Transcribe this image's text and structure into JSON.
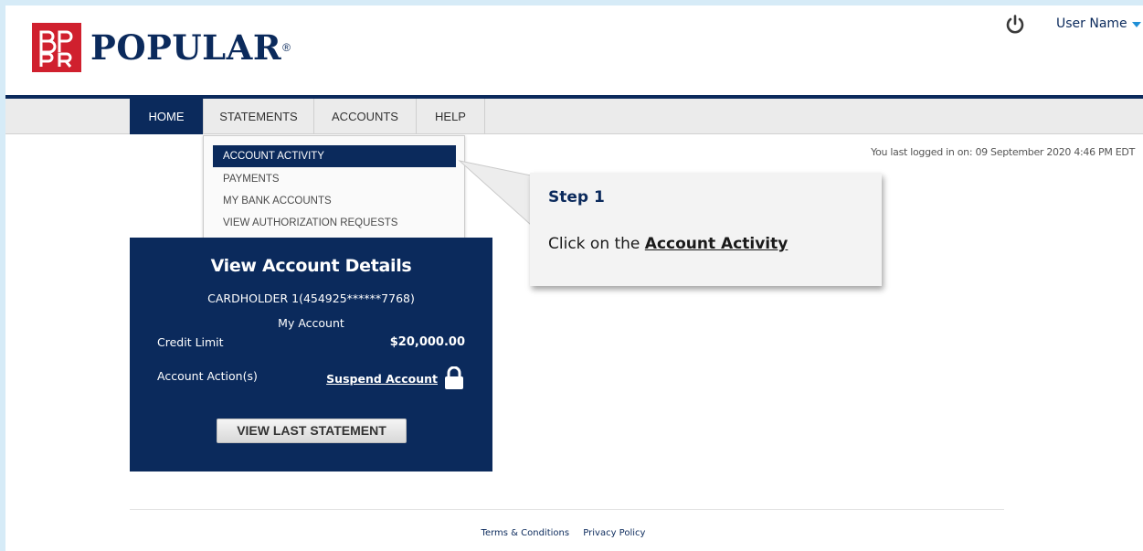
{
  "header": {
    "brand": "POPULAR",
    "brand_mark": "®",
    "user_name": "User Name"
  },
  "nav": {
    "items": [
      {
        "label": "HOME",
        "active": true
      },
      {
        "label": "STATEMENTS",
        "active": false
      },
      {
        "label": "ACCOUNTS",
        "active": false
      },
      {
        "label": "HELP",
        "active": false
      }
    ]
  },
  "dropdown": {
    "items": [
      {
        "label": "ACCOUNT ACTIVITY",
        "selected": true
      },
      {
        "label": "PAYMENTS",
        "selected": false
      },
      {
        "label": "MY BANK ACCOUNTS",
        "selected": false
      },
      {
        "label": "VIEW AUTHORIZATION REQUESTS",
        "selected": false
      }
    ]
  },
  "last_login": "You last logged in on: 09 September 2020 4:46 PM EDT",
  "callout": {
    "title": "Step 1",
    "text_prefix": "Click on the ",
    "text_emphasis": "Account Activity"
  },
  "account_panel": {
    "title": "View Account Details",
    "cardholder": "CARDHOLDER 1(454925******7768)",
    "subtitle": "My Account",
    "credit_limit_label": "Credit Limit",
    "credit_limit_value": "$20,000.00",
    "account_actions_label": "Account Action(s)",
    "suspend_label": "Suspend Account",
    "view_statement_button": "VIEW LAST STATEMENT"
  },
  "footer": {
    "terms": "Terms & Conditions",
    "privacy": "Privacy Policy"
  },
  "colors": {
    "navy": "#0b2a5c",
    "brand_red": "#d0202e",
    "frame_blue": "#d6ebf7",
    "caret_blue": "#1f8fd6"
  },
  "icons": {
    "logo": "bppr-logo-icon",
    "power": "power-icon",
    "user_caret": "chevron-down-icon",
    "lock": "lock-icon"
  }
}
